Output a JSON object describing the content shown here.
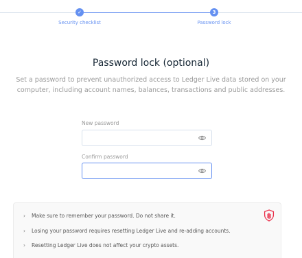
{
  "stepper": {
    "steps": [
      {
        "label": "Security checklist",
        "dot": "✓",
        "state": "done"
      },
      {
        "label": "Password lock",
        "dot": "3",
        "state": "active"
      }
    ],
    "accent_color": "#6490f1"
  },
  "page": {
    "title": "Password lock (optional)",
    "description": "Set a password to prevent unauthorized access to Ledger Live data stored on your computer, including account names, balances, transactions and public addresses."
  },
  "form": {
    "new_password_label": "New password",
    "new_password_value": "",
    "confirm_password_label": "Confirm password",
    "confirm_password_value": "",
    "visibility_icon": "eye-icon"
  },
  "notes": {
    "icon": "shield-hand-icon",
    "items": [
      "Make sure to remember your password. Do not share it.",
      "Losing your password requires resetting Ledger Live and re-adding accounts.",
      "Resetting Ledger Live does not affect your crypto assets."
    ],
    "warning_color": "#ea2e49"
  }
}
